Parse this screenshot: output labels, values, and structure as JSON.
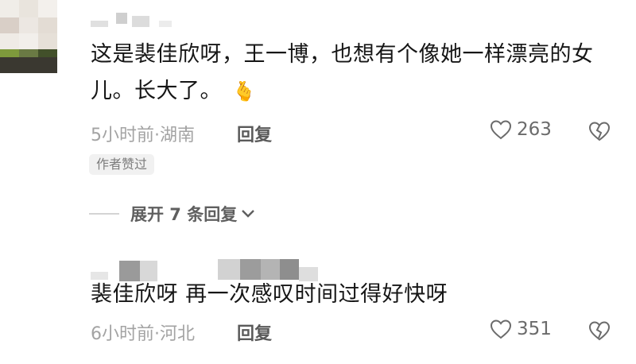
{
  "comments": [
    {
      "username": "",
      "text_line1": "这是裴佳欣呀，王一博，也想有个像她一样漂亮的女",
      "text_line2": "儿。长大了。",
      "emoji": "🫰",
      "time_location": "5小时前·湖南",
      "reply_label": "回复",
      "likes": "263",
      "badge": "作者赞过",
      "expand_label": "展开 7 条回复"
    },
    {
      "username": "",
      "text_line1": "裴佳欣呀 再一次感叹时间过得好快呀",
      "time_location": "6小时前·河北",
      "reply_label": "回复",
      "likes": "351"
    }
  ],
  "icons": {
    "like": "heart-outline-icon",
    "dislike": "broken-heart-icon",
    "expand": "chevron-down-icon"
  },
  "colors": {
    "text": "#161616",
    "meta": "#a3a3a3",
    "badge_bg": "#f1f1f1"
  }
}
